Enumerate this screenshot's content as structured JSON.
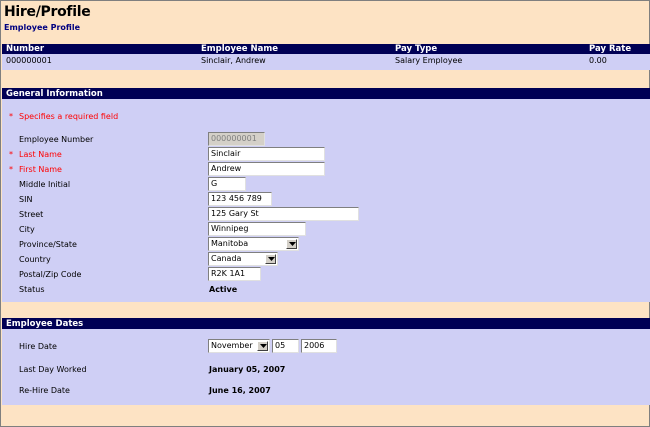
{
  "page": {
    "title": "Hire/Profile",
    "subtitle": "Employee Profile"
  },
  "summary": {
    "headers": [
      "Number",
      "Employee Name",
      "Pay Type",
      "Pay Rate"
    ],
    "row": [
      "000000001",
      "Sinclair, Andrew",
      "Salary Employee",
      "0.00"
    ]
  },
  "general": {
    "section_title": "General Information",
    "required_note": "Specifies a required field",
    "required_marker": "*",
    "fields": {
      "employee_number": {
        "label": "Employee Number",
        "value": "000000001"
      },
      "last_name": {
        "label": "Last Name",
        "value": "Sinclair"
      },
      "first_name": {
        "label": "First Name",
        "value": "Andrew"
      },
      "middle_initial": {
        "label": "Middle Initial",
        "value": "G"
      },
      "sin": {
        "label": "SIN",
        "value": "123 456 789"
      },
      "street": {
        "label": "Street",
        "value": "125 Gary St"
      },
      "city": {
        "label": "City",
        "value": "Winnipeg"
      },
      "province": {
        "label": "Province/State",
        "value": "Manitoba"
      },
      "country": {
        "label": "Country",
        "value": "Canada"
      },
      "postal": {
        "label": "Postal/Zip Code",
        "value": "R2K 1A1"
      },
      "status": {
        "label": "Status",
        "value": "Active"
      }
    }
  },
  "dates": {
    "section_title": "Employee Dates",
    "hire_date": {
      "label": "Hire Date",
      "month": "November",
      "day": "05",
      "year": "2006"
    },
    "last_day_worked": {
      "label": "Last Day Worked",
      "value": "January 05, 2007"
    },
    "rehire_date": {
      "label": "Re-Hire Date",
      "value": "June 16, 2007"
    }
  },
  "colors": {
    "peach": "#fde3c4",
    "lavender": "#cfcff5",
    "navy": "#000055",
    "required": "#ff0000"
  }
}
